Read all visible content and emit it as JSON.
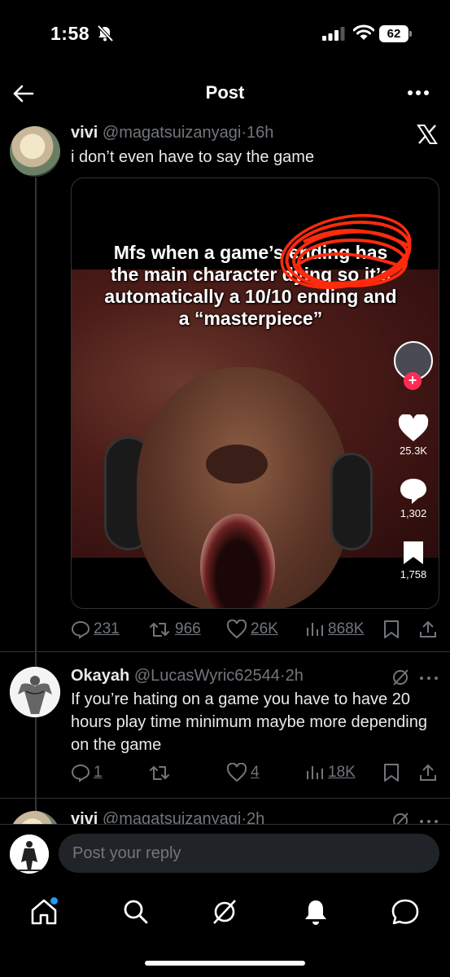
{
  "status": {
    "time": "1:58",
    "battery": "62",
    "mute_icon": "bell-slash-icon",
    "signal_icon": "cellular-signal-icon",
    "wifi_icon": "wifi-icon"
  },
  "nav": {
    "title": "Post",
    "back_icon": "arrow-left-icon",
    "more_icon": "ellipsis-icon"
  },
  "main_post": {
    "display_name": "vivi",
    "handle": "@magatsuizanyagi",
    "separator": "·",
    "age": "16h",
    "text": "i don’t even have to say the game",
    "media": {
      "caption": "Mfs when a game’s ending has the main character dying so it’s automatically a 10/10 ending and a “masterpiece”",
      "likes": "25.3K",
      "comments": "1,302",
      "saves": "1,758"
    },
    "actions": {
      "replies": "231",
      "reposts": "966",
      "likes": "26K",
      "views": "868K"
    }
  },
  "reply_1": {
    "display_name": "Okayah",
    "handle": "@LucasWyric62544",
    "separator": "·",
    "age": "2h",
    "text": "If you’re hating on a game you have to have 20 hours play time minimum maybe more depending on the game",
    "actions": {
      "replies": "1",
      "reposts": "",
      "likes": "4",
      "views": "18K"
    }
  },
  "reply_2": {
    "display_name": "vivi",
    "handle": "@magatsuizanyagi",
    "separator": "·",
    "age": "2h"
  },
  "composer": {
    "placeholder": "Post your reply"
  },
  "tabs": [
    "home-icon",
    "search-icon",
    "grok-icon",
    "notifications-icon",
    "messages-icon"
  ],
  "colors": {
    "background": "#000000",
    "text": "#e7e9ea",
    "muted": "#71767b",
    "accent": "#1d9bf0",
    "scribble": "#ff2a0d",
    "tiktok_red": "#fe2c55"
  }
}
